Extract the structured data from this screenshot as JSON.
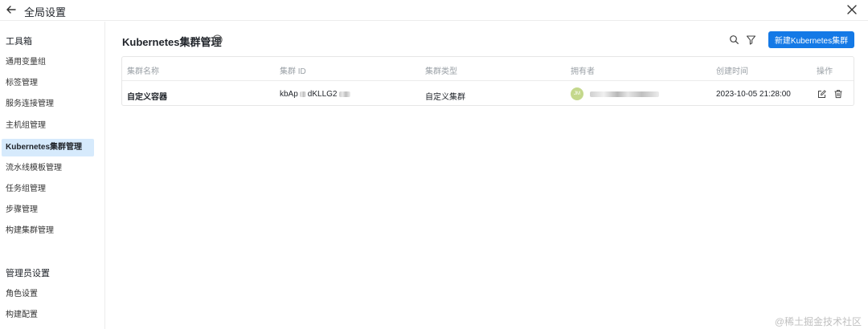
{
  "header": {
    "title": "全局设置"
  },
  "sidebar": {
    "groups": [
      {
        "title": "工具箱",
        "items": [
          "通用变量组",
          "标签管理",
          "服务连接管理",
          "主机组管理",
          "Kubernetes集群管理",
          "流水线模板管理",
          "任务组管理",
          "步骤管理",
          "构建集群管理"
        ]
      },
      {
        "title": "管理员设置",
        "items": [
          "角色设置",
          "构建配置"
        ]
      }
    ],
    "active_item": "Kubernetes集群管理"
  },
  "main": {
    "title": "Kubernetes集群管理",
    "new_button": "新建Kubernetes集群",
    "table": {
      "columns": [
        "集群名称",
        "集群 ID",
        "集群类型",
        "拥有者",
        "创建时间",
        "操作"
      ],
      "rows": [
        {
          "name": "自定义容器",
          "id_prefix": "kbAp",
          "id_mid": "dKLLG2",
          "type": "自定义集群",
          "owner_avatar": "JM",
          "created": "2023-10-05 21:28:00"
        }
      ]
    }
  },
  "watermark": "@稀土掘金技术社区",
  "colors": {
    "primary": "#1479e6",
    "active_bg": "#d6eafc",
    "avatar": "#c4d88c"
  }
}
